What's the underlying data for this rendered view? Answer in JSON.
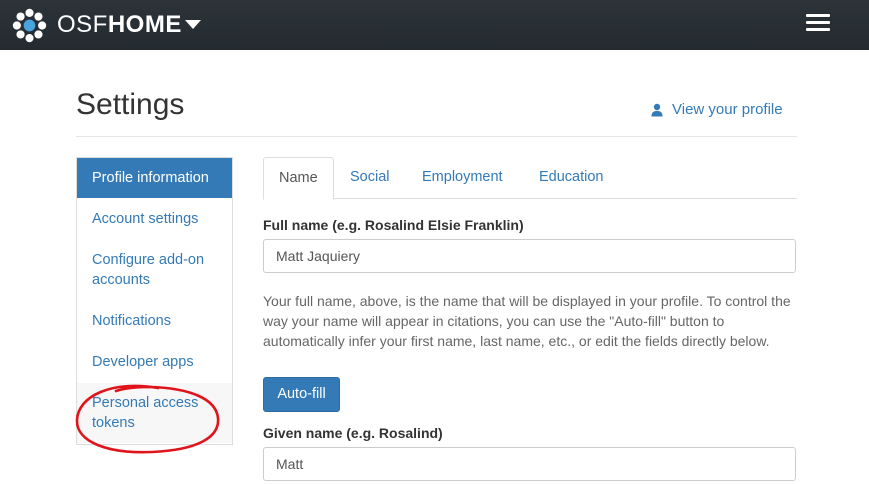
{
  "header": {
    "brand_light": "OSF",
    "brand_bold": "HOME",
    "logo_icon": "osf-logo-icon",
    "menu_icon": "hamburger-menu-icon"
  },
  "page": {
    "title": "Settings",
    "view_profile": "View your profile"
  },
  "sidebar": {
    "items": [
      {
        "label": "Profile information"
      },
      {
        "label": "Account settings"
      },
      {
        "label": "Configure add-on accounts"
      },
      {
        "label": "Notifications"
      },
      {
        "label": "Developer apps"
      },
      {
        "label": "Personal access tokens"
      }
    ]
  },
  "tabs": [
    {
      "label": "Name"
    },
    {
      "label": "Social"
    },
    {
      "label": "Employment"
    },
    {
      "label": "Education"
    }
  ],
  "form": {
    "full_name_label": "Full name (e.g. Rosalind Elsie Franklin)",
    "full_name_value": "Matt Jaquiery",
    "help_text": "Your full name, above, is the name that will be displayed in your profile. To control the way your name will appear in citations, you can use the \"Auto-fill\" button to automatically infer your first name, last name, etc., or edit the fields directly below.",
    "autofill_label": "Auto-fill",
    "given_name_label": "Given name (e.g. Rosalind)",
    "given_name_value": "Matt"
  },
  "colors": {
    "topbar": "#263238",
    "accent": "#337ab7",
    "annotation": "#e0151b"
  }
}
